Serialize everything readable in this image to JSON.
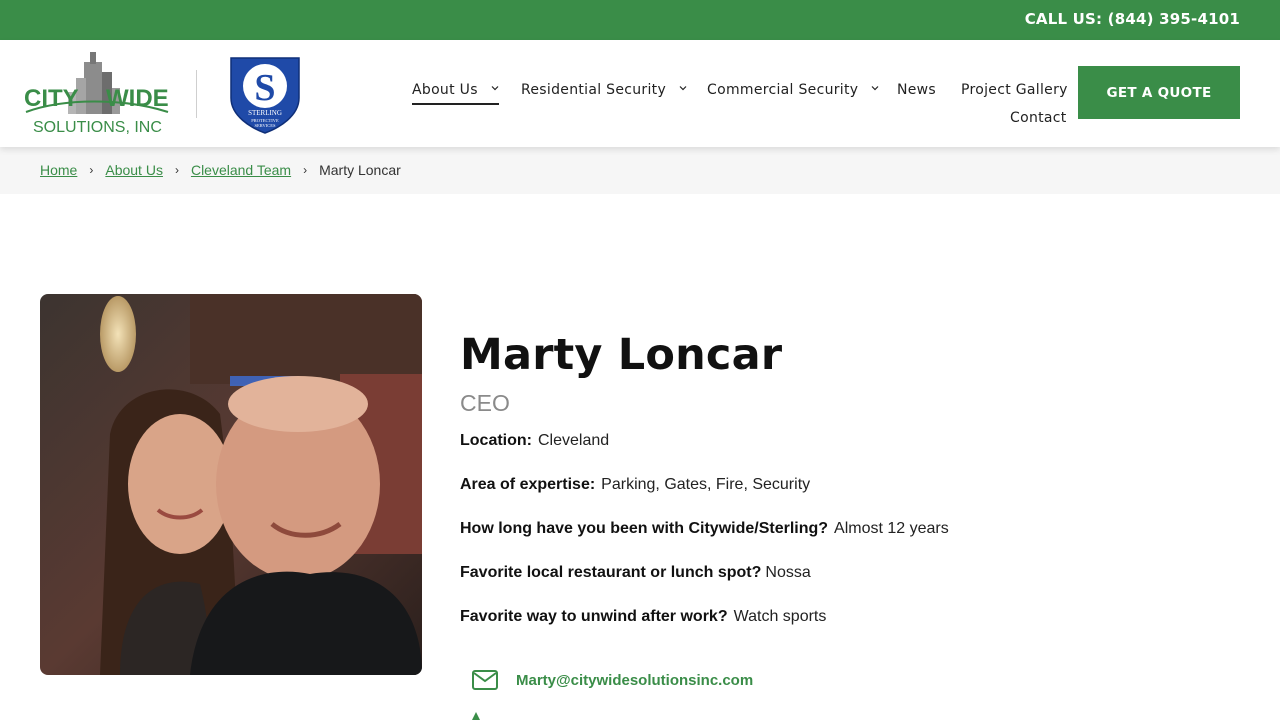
{
  "topbar": {
    "call": "CALL US: (844) 395-4101"
  },
  "logos": {
    "citywide_line1_a": "CITY",
    "citywide_line1_b": "WIDE",
    "citywide_line2": "SOLUTIONS, INC",
    "sterling_letter": "S",
    "sterling_text1": "STERLING",
    "sterling_text2": "PROTECTIVE",
    "sterling_text3": "SERVICES"
  },
  "nav": {
    "about": "About Us",
    "residential": "Residential Security",
    "commercial": "Commercial Security",
    "news": "News",
    "gallery": "Project Gallery",
    "contact": "Contact"
  },
  "cta": {
    "quote": "GET A QUOTE"
  },
  "breadcrumb": {
    "home": "Home",
    "about": "About Us",
    "team": "Cleveland Team",
    "current": "Marty Loncar"
  },
  "profile": {
    "name": "Marty Loncar",
    "title": "CEO",
    "fields": [
      {
        "label": "Location:",
        "value": "Cleveland"
      },
      {
        "label": "Area of expertise:",
        "value": "Parking, Gates, Fire, Security"
      },
      {
        "label": "How long have you been with Citywide/Sterling?",
        "value": "Almost 12 years"
      },
      {
        "label": "Favorite local restaurant or lunch spot?",
        "value": "Nossa"
      },
      {
        "label": "Favorite way to unwind after work?",
        "value": "Watch sports"
      }
    ],
    "email": "Marty@citywidesolutionsinc.com"
  },
  "icons": {
    "chevron": "chevron-down-icon",
    "breadcrumb_sep": "chevron-right-icon",
    "email": "envelope-icon",
    "phone": "phone-icon"
  },
  "colors": {
    "brand_green": "#3a8d48",
    "sterling_blue": "#1f4aa8"
  }
}
